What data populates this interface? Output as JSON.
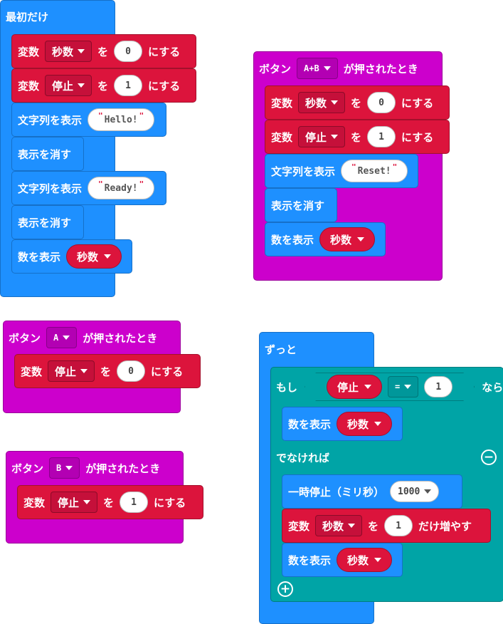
{
  "colors": {
    "basic": "#1e90ff",
    "variables": "#dc143c",
    "input": "#cc00cc",
    "logic": "#00a4a6"
  },
  "start": {
    "hat": "最初だけ",
    "set1": {
      "prefix": "変数",
      "var": "秒数",
      "to": "を",
      "value": "0",
      "suffix": "にする"
    },
    "set2": {
      "prefix": "変数",
      "var": "停止",
      "to": "を",
      "value": "1",
      "suffix": "にする"
    },
    "show1": {
      "label": "文字列を表示",
      "text": "Hello!"
    },
    "clear1": "表示を消す",
    "show2": {
      "label": "文字列を表示",
      "text": "Ready!"
    },
    "clear2": "表示を消す",
    "shownum": {
      "label": "数を表示",
      "var": "秒数"
    }
  },
  "ab": {
    "hat_prefix": "ボタン",
    "button": "A+B",
    "hat_suffix": "が押されたとき",
    "set1": {
      "prefix": "変数",
      "var": "秒数",
      "to": "を",
      "value": "0",
      "suffix": "にする"
    },
    "set2": {
      "prefix": "変数",
      "var": "停止",
      "to": "を",
      "value": "1",
      "suffix": "にする"
    },
    "show": {
      "label": "文字列を表示",
      "text": "Reset!"
    },
    "clear": "表示を消す",
    "shownum": {
      "label": "数を表示",
      "var": "秒数"
    }
  },
  "a": {
    "hat_prefix": "ボタン",
    "button": "A",
    "hat_suffix": "が押されたとき",
    "set": {
      "prefix": "変数",
      "var": "停止",
      "to": "を",
      "value": "0",
      "suffix": "にする"
    }
  },
  "b": {
    "hat_prefix": "ボタン",
    "button": "B",
    "hat_suffix": "が押されたとき",
    "set": {
      "prefix": "変数",
      "var": "停止",
      "to": "を",
      "value": "1",
      "suffix": "にする"
    }
  },
  "forever": {
    "hat": "ずっと",
    "if": {
      "label": "もし",
      "var": "停止",
      "op": "=",
      "value": "1",
      "then": "なら"
    },
    "shownum1": {
      "label": "数を表示",
      "var": "秒数"
    },
    "else": "でなければ",
    "pause": {
      "label": "一時停止（ミリ秒）",
      "value": "1000"
    },
    "change": {
      "prefix": "変数",
      "var": "秒数",
      "to": "を",
      "value": "1",
      "suffix": "だけ増やす"
    },
    "shownum2": {
      "label": "数を表示",
      "var": "秒数"
    }
  }
}
